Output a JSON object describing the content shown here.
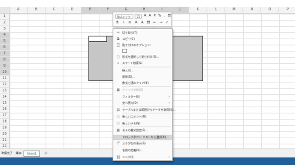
{
  "sheet": {
    "columns": [
      "A",
      "B",
      "C",
      "D",
      "E",
      "F",
      "G",
      "H",
      "I",
      "J",
      "K",
      "L",
      "M",
      "N",
      "O",
      "P"
    ],
    "rows": [
      "1",
      "2",
      "3",
      "4",
      "5",
      "6",
      "7",
      "8",
      "9",
      "10",
      "11",
      "12",
      "13",
      "14",
      "15",
      "16",
      "17",
      "18",
      "19",
      "20",
      "21",
      "22"
    ],
    "tab_label": "Sheet1",
    "nav_prev": "◀",
    "nav_next": "▶",
    "add_sheet": "+"
  },
  "status": {
    "left": "準備完了",
    "right": "四"
  },
  "mini_toolbar": {
    "font_name": "游ゴシック",
    "font_size": "11",
    "buttons_row1": [
      "A",
      "A",
      "¥",
      "%",
      ",",
      "田"
    ],
    "buttons_row2": [
      "B",
      "I",
      "≡",
      "A",
      "A",
      "田",
      "←",
      "→",
      "✓"
    ]
  },
  "context_menu": {
    "items": [
      {
        "icon": "scissors-icon",
        "glyph": "✂",
        "label": "切り取り(T)",
        "disabled": false
      },
      {
        "icon": "copy-icon",
        "glyph": "⧉",
        "label": "コピー(C)",
        "disabled": false
      },
      {
        "icon": "paste-icon",
        "glyph": "📋",
        "label": "貼り付けのオプション:",
        "disabled": false
      },
      {
        "icon": "paste-special-icon",
        "glyph": "▢",
        "label": "形式を選択して貼り付け(S)...",
        "disabled": false
      },
      {
        "icon": "smart-lookup-icon",
        "glyph": "⌕",
        "label": "スマート検索(L)",
        "disabled": false
      },
      {
        "icon": "insert-icon",
        "glyph": "",
        "label": "挿入(I)...",
        "disabled": false
      },
      {
        "icon": "delete-icon",
        "glyph": "",
        "label": "削除(D)...",
        "disabled": false
      },
      {
        "icon": "clear-icon",
        "glyph": "",
        "label": "数式と値のクリア(N)",
        "disabled": false
      },
      {
        "icon": "quick-analysis-icon",
        "glyph": "▦",
        "label": "クイック分析(Q)",
        "disabled": true
      },
      {
        "icon": "filter-icon",
        "glyph": "",
        "label": "フィルター(E)",
        "disabled": false,
        "submenu": true
      },
      {
        "icon": "sort-icon",
        "glyph": "",
        "label": "並べ替え(O)",
        "disabled": false,
        "submenu": true
      },
      {
        "icon": "table-range-icon",
        "glyph": "▤",
        "label": "テーブルまたは範囲からデータを取得(G)...",
        "disabled": false
      },
      {
        "icon": "comment-icon",
        "glyph": "▭",
        "label": "新しいコメント(M)",
        "disabled": false
      },
      {
        "icon": "note-icon",
        "glyph": "▭",
        "label": "新しいメモ(N)",
        "disabled": false
      },
      {
        "icon": "format-cells-icon",
        "glyph": "▦",
        "label": "セルの書式設定(F)...",
        "disabled": false
      },
      {
        "icon": "dropdown-icon",
        "glyph": "",
        "label": "ドロップダウン リストから選択(K)...",
        "disabled": false,
        "highlight": true
      },
      {
        "icon": "phonetic-icon",
        "glyph": "ア",
        "label": "ふりがなの表示(S)",
        "disabled": false
      },
      {
        "icon": "define-name-icon",
        "glyph": "",
        "label": "名前の定義(A)...",
        "disabled": false
      },
      {
        "icon": "link-icon",
        "glyph": "⛓",
        "label": "リンク(I)",
        "disabled": false,
        "submenu": true
      }
    ],
    "submenu_arrow": "›"
  }
}
